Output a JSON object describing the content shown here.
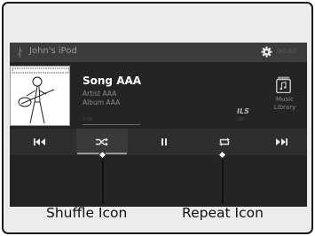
{
  "header": {
    "source_name": "John's iPod",
    "clock": "00:00"
  },
  "track": {
    "title": "Song AAA",
    "artist": "Artist AAA",
    "album": "Album AAA",
    "elapsed": "0:00"
  },
  "right_panel": {
    "ils_label": "ILS",
    "ils_sublabel": "Off",
    "library_label_line1": "Music",
    "library_label_line2": "Library"
  },
  "controls": {
    "previous": "skip-back-icon",
    "shuffle": "shuffle-icon",
    "pause": "pause-icon",
    "repeat": "repeat-icon",
    "next": "skip-forward-icon"
  },
  "callouts": {
    "shuffle": "Shuffle Icon",
    "repeat": "Repeat Icon"
  }
}
